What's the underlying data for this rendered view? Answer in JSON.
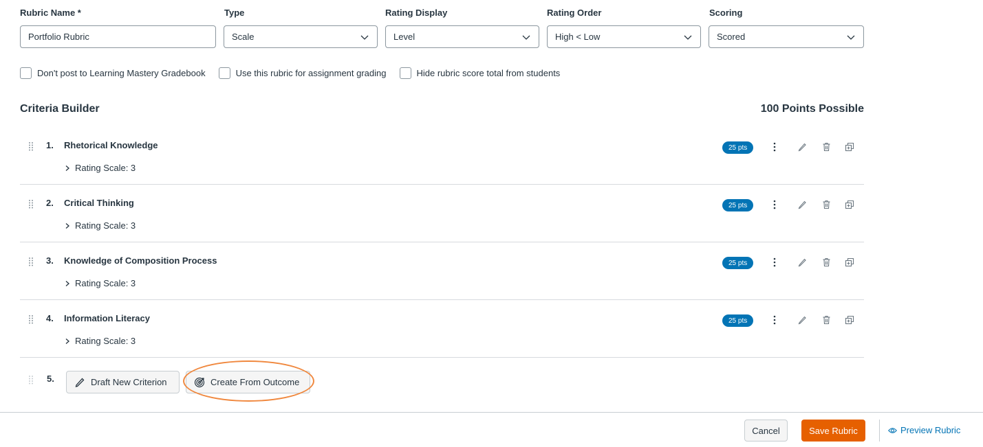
{
  "form": {
    "rubric_name": {
      "label": "Rubric Name *",
      "value": "Portfolio Rubric"
    },
    "type": {
      "label": "Type",
      "value": "Scale"
    },
    "rating_display": {
      "label": "Rating Display",
      "value": "Level"
    },
    "rating_order": {
      "label": "Rating Order",
      "value": "High < Low"
    },
    "scoring": {
      "label": "Scoring",
      "value": "Scored"
    }
  },
  "options": [
    {
      "label": "Don't post to Learning Mastery Gradebook",
      "checked": false
    },
    {
      "label": "Use this rubric for assignment grading",
      "checked": false
    },
    {
      "label": "Hide rubric score total from students",
      "checked": false
    }
  ],
  "criteria_builder": {
    "title": "Criteria Builder",
    "points_possible": "100 Points Possible",
    "criteria": [
      {
        "number": "1.",
        "title": "Rhetorical Knowledge",
        "rating_scale": "Rating Scale: 3",
        "points": "25 pts"
      },
      {
        "number": "2.",
        "title": "Critical Thinking",
        "rating_scale": "Rating Scale: 3",
        "points": "25 pts"
      },
      {
        "number": "3.",
        "title": "Knowledge of Composition Process",
        "rating_scale": "Rating Scale: 3",
        "points": "25 pts"
      },
      {
        "number": "4.",
        "title": "Information Literacy",
        "rating_scale": "Rating Scale: 3",
        "points": "25 pts"
      }
    ],
    "new_criterion": {
      "number": "5.",
      "draft_label": "Draft New Criterion",
      "outcome_label": "Create From Outcome"
    }
  },
  "footer": {
    "cancel_label": "Cancel",
    "save_label": "Save Rubric",
    "preview_label": "Preview Rubric"
  },
  "colors": {
    "accent_blue": "#0374b5",
    "save_orange": "#e66000",
    "highlight_ring": "#f0883e",
    "text": "#273540"
  },
  "icons": {
    "drag": "drag-handle-icon",
    "kebab": "more-options-icon",
    "edit": "pencil-icon",
    "delete": "trash-icon",
    "duplicate": "duplicate-icon",
    "outcome": "target-icon",
    "preview": "eye-icon"
  }
}
